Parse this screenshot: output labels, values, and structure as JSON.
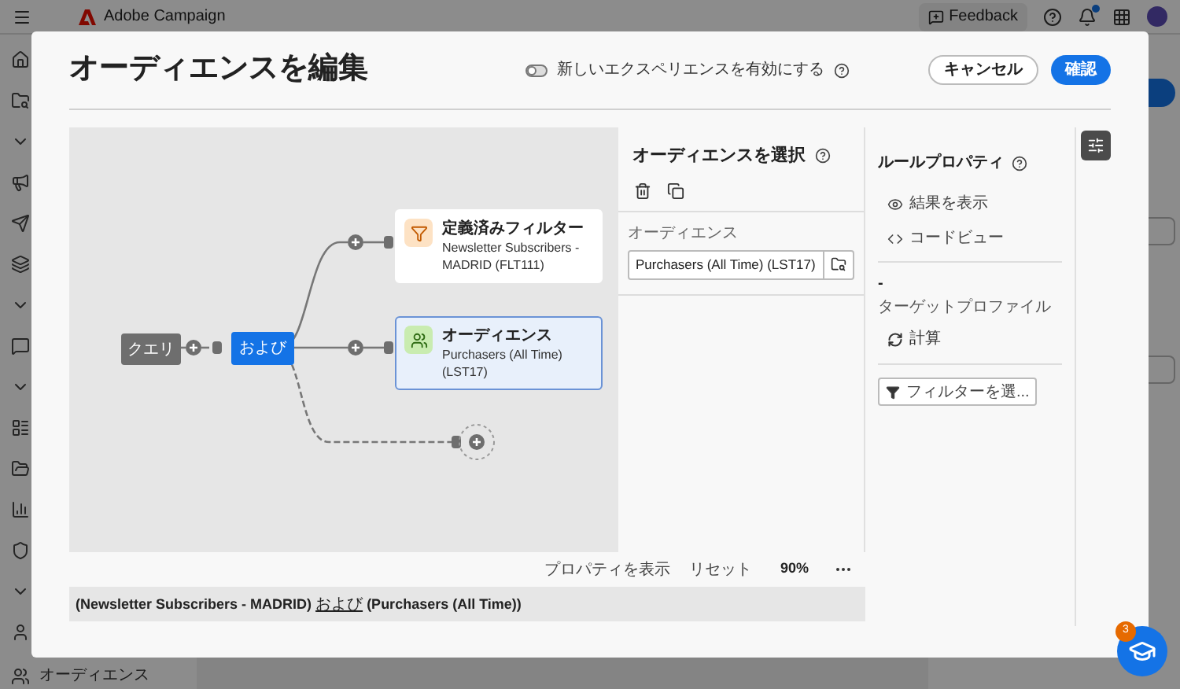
{
  "app_bar": {
    "product": "Adobe Campaign",
    "feedback": "Feedback",
    "notification_dot": true
  },
  "sidebar": {
    "bottom_label": "オーディエンス"
  },
  "dialog": {
    "title": "オーディエンスを編集",
    "toggle": {
      "label": "新しいエクスペリエンスを有効にする",
      "on": false
    },
    "buttons": [
      {
        "label": "キャンセル",
        "kind": "secondary"
      },
      {
        "label": "確認",
        "kind": "primary"
      }
    ],
    "canvas": {
      "nodes": [
        {
          "kind": "start",
          "label": "クエリ"
        },
        {
          "kind": "operator",
          "label": "および"
        },
        {
          "kind": "filter",
          "title": "定義済みフィルター",
          "subtitle": "Newsletter Subscribers - MADRID (FLT111)",
          "selected": false
        },
        {
          "kind": "audience",
          "title": "オーディエンス",
          "subtitle": "Purchasers (All Time) (LST17)",
          "selected": true
        }
      ]
    },
    "canvas_footer": {
      "actions": [
        "プロパティを表示",
        "リセット"
      ],
      "zoom": "90%"
    },
    "selection_panel": {
      "title": "オーディエンスを選択",
      "field": {
        "label": "オーディエンス",
        "value": "Purchasers (All Time) (LST17)"
      }
    },
    "rule_properties": {
      "title": "ルールプロパティ",
      "actions": [
        {
          "kind": "view",
          "label": "結果を表示"
        },
        {
          "kind": "code",
          "label": "コードビュー"
        }
      ],
      "count": "-",
      "count_label": "ターゲットプロファイル",
      "compute": "計算",
      "filter_button": "フィルターを選..."
    },
    "expression": {
      "before": "(Newsletter Subscribers - MADRID)",
      "link": "および",
      "after": "(Purchasers (All Time))"
    }
  },
  "help_badge": "3"
}
